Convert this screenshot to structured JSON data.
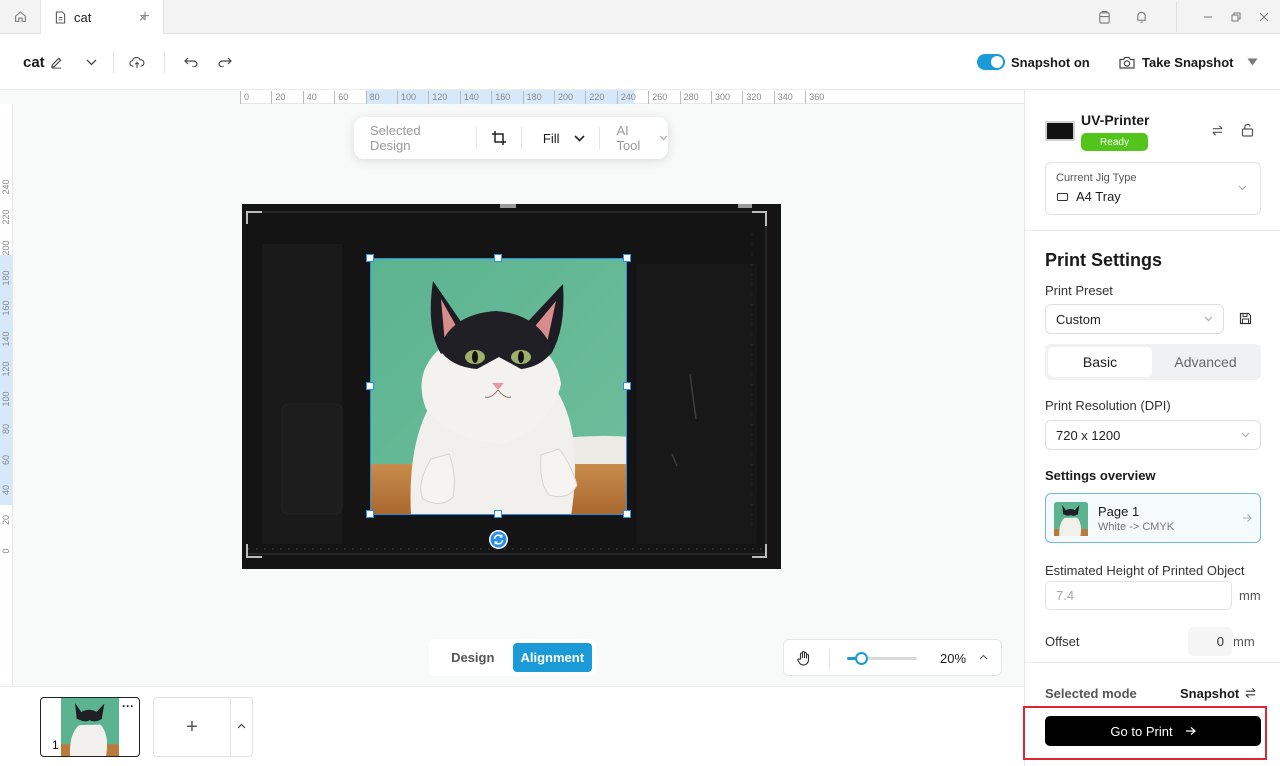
{
  "titlebar": {
    "tab_label": "cat",
    "tab_close": "×",
    "new_tab": "+"
  },
  "toolbar": {
    "doc_name": "cat",
    "snapshot_toggle_label": "Snapshot on",
    "snapshot_on": true,
    "take_snapshot_label": "Take Snapshot"
  },
  "rulers": {
    "horizontal": [
      "0",
      "20",
      "40",
      "60",
      "80",
      "100",
      "120",
      "140",
      "160",
      "180",
      "200",
      "220",
      "240",
      "260",
      "280",
      "300",
      "320",
      "340",
      "360"
    ],
    "vertical": [
      "240",
      "220",
      "200",
      "180",
      "160",
      "140",
      "120",
      "100",
      "80",
      "60",
      "40",
      "20",
      "0"
    ]
  },
  "context_bar": {
    "selected_design": "Selected Design",
    "fill_label": "Fill",
    "ai_tool_label": "AI Tool"
  },
  "canvas_modes": {
    "design": "Design",
    "alignment": "Alignment",
    "active": "alignment"
  },
  "zoom": {
    "value_label": "20%",
    "slider_fraction": 0.2
  },
  "pages": {
    "items": [
      {
        "number": "1",
        "more": "···"
      }
    ],
    "add_label": "+"
  },
  "printer": {
    "name": "UV-Printer",
    "status": "Ready",
    "jig_label": "Current Jig Type",
    "jig_value": "A4 Tray"
  },
  "print_settings": {
    "title": "Print Settings",
    "preset_label": "Print Preset",
    "preset_value": "Custom",
    "tabs": [
      "Basic",
      "Advanced"
    ],
    "active_tab": "Basic",
    "resolution_label": "Print Resolution (DPI)",
    "resolution_value": "720 x 1200",
    "overview_label": "Settings overview",
    "overview_page": "Page 1",
    "overview_mode": "White -> CMYK",
    "height_label": "Estimated Height of Printed Object",
    "height_placeholder": "7.4",
    "height_unit": "mm",
    "offset_label": "Offset",
    "offset_value": "0",
    "offset_unit": "mm"
  },
  "footer": {
    "selected_mode_label": "Selected mode",
    "selected_mode_value": "Snapshot",
    "go_to_print": "Go to Print"
  },
  "colors": {
    "accent": "#1a9ad6",
    "ready": "#52c41a",
    "highlight_box": "#e0262e"
  }
}
